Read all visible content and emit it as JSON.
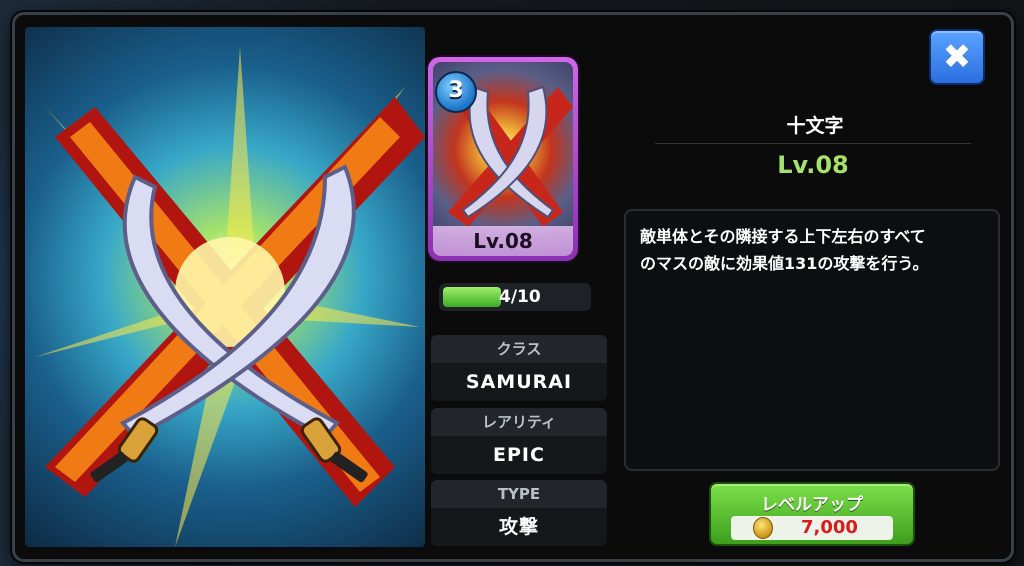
{
  "skill": {
    "name": "十文字",
    "level": "Lv.08",
    "cost": "3",
    "card_level": "Lv.08",
    "progress_text": "4/10",
    "progress_fraction": 0.4,
    "description_line1": "敵単体とその隣接する上下左右のすべて",
    "description_line2": "のマスの敵に効果値131の攻撃を行う。"
  },
  "info": {
    "class_label": "クラス",
    "class_value": "SAMURAI",
    "rarity_label": "レアリティ",
    "rarity_value": "EPIC",
    "type_label": "TYPE",
    "type_value": "攻撃"
  },
  "levelup": {
    "label": "レベルアップ",
    "cost": "7,000",
    "currency_icon": "gold-coin-icon"
  },
  "close": {
    "icon": "close-icon",
    "glyph": "✖"
  },
  "colors": {
    "card_frame": "#b04fd6",
    "level_green": "#a6e26b",
    "levelup_button": "#5cc332",
    "close_button": "#3d86ee",
    "cost_red": "#d81c1c"
  }
}
